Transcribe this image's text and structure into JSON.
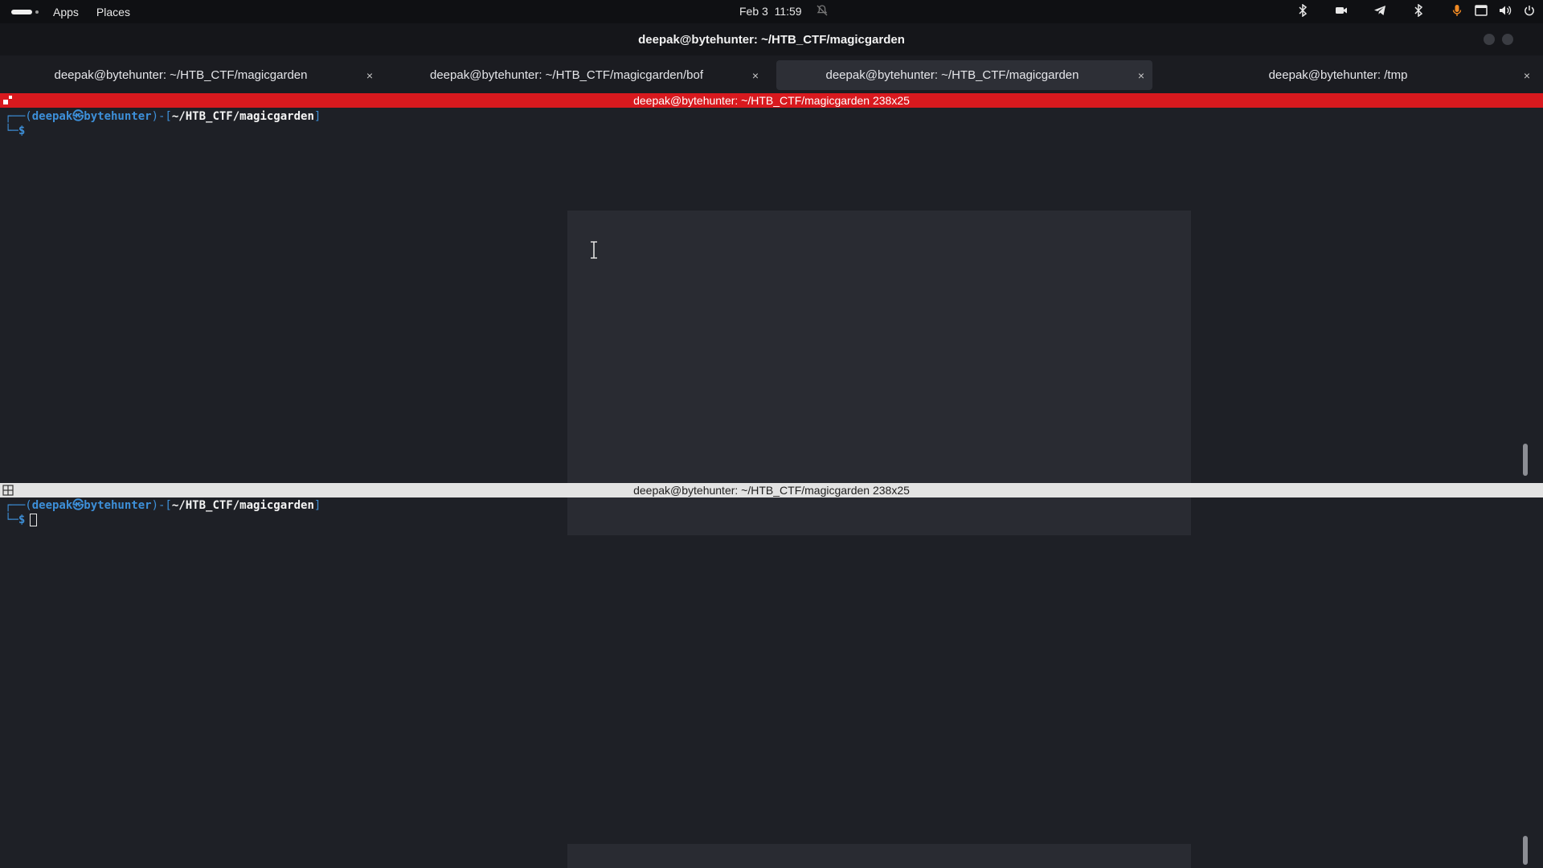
{
  "topbar": {
    "apps_label": "Apps",
    "places_label": "Places",
    "date": "Feb 3",
    "time": "11:59",
    "tray_icons": [
      "bluetooth-icon",
      "camera-icon",
      "telegram-icon",
      "bluetooth-icon",
      "microphone-icon",
      "window-icon",
      "volume-icon",
      "power-icon"
    ]
  },
  "window": {
    "title": "deepak@bytehunter: ~/HTB_CTF/magicgarden"
  },
  "tabs": [
    {
      "label": "deepak@bytehunter: ~/HTB_CTF/magicgarden",
      "active": false
    },
    {
      "label": "deepak@bytehunter: ~/HTB_CTF/magicgarden/bof",
      "active": false
    },
    {
      "label": "deepak@bytehunter: ~/HTB_CTF/magicgarden",
      "active": true
    },
    {
      "label": "deepak@bytehunter: /tmp",
      "active": false
    }
  ],
  "tab_close_glyph": "×",
  "panes": {
    "top": {
      "header": "deepak@bytehunter: ~/HTB_CTF/magicgarden 238x25",
      "header_color": "#d8191e",
      "prompt": {
        "frame_open": "┌──(",
        "user_host": "deepak㉿bytehunter",
        "mid": ")-[",
        "path": "~/HTB_CTF/magicgarden",
        "frame_close": "]",
        "line2": "└─",
        "dollar": "$"
      }
    },
    "bottom": {
      "header": "deepak@bytehunter: ~/HTB_CTF/magicgarden 238x25",
      "header_color": "#e3e3e3",
      "prompt": {
        "frame_open": "┌──(",
        "user_host": "deepak㉿bytehunter",
        "mid": ")-[",
        "path": "~/HTB_CTF/magicgarden",
        "frame_close": "]",
        "line2": "└─",
        "dollar": "$"
      }
    }
  },
  "colors": {
    "prompt_blue": "#3d8fd8",
    "background": "#1e2026"
  }
}
